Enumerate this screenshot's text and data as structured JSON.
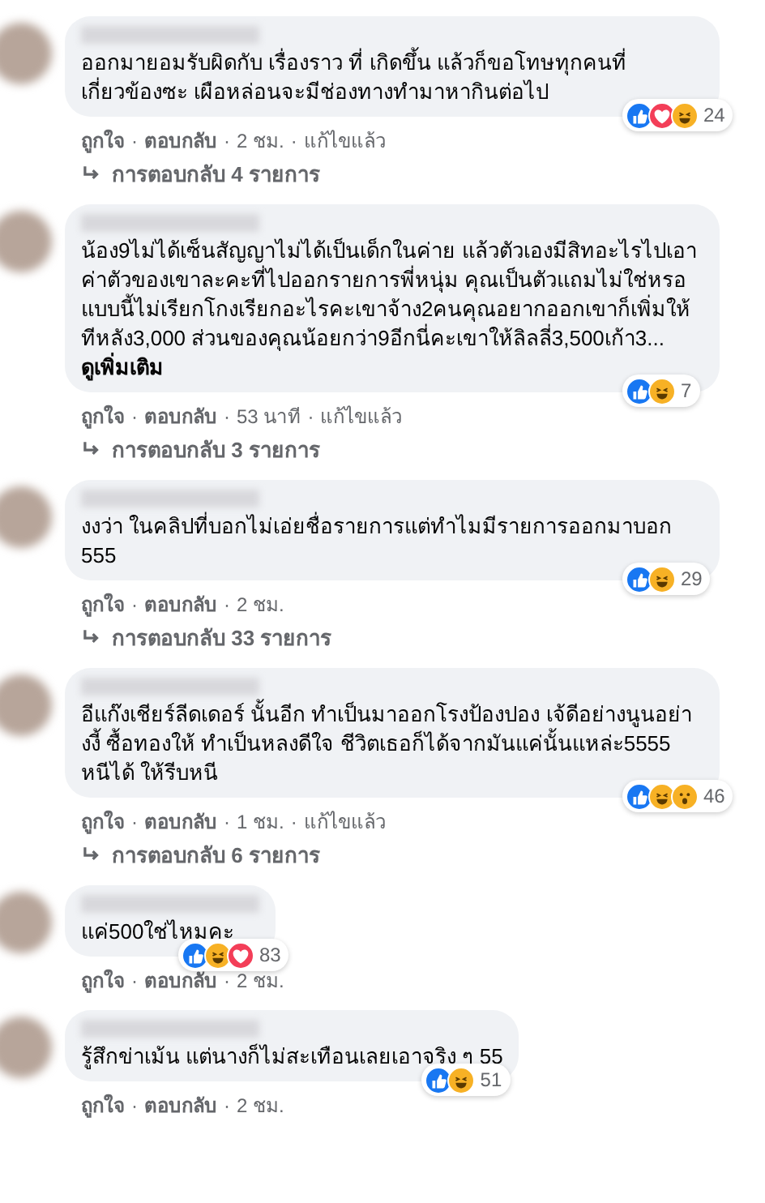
{
  "comments": [
    {
      "text": "ออกมายอมรับผิดกับ เรื่องราว ที่ เกิดขึ้น แล้วก็ขอโทษทุกคนที่เกี่ยวข้องซะ เผือหล่อนจะมีช่องทางทำมาหากินต่อไป",
      "reactions": [
        {
          "kind": "like"
        },
        {
          "kind": "love"
        },
        {
          "kind": "haha"
        }
      ],
      "reaction_count": "24",
      "actions": [
        {
          "kind": "link",
          "text": "ถูกใจ"
        },
        {
          "kind": "separator",
          "text": "·"
        },
        {
          "kind": "link",
          "text": "ตอบกลับ"
        },
        {
          "kind": "separator",
          "text": "·"
        },
        {
          "kind": "meta",
          "text": "2 ชม."
        },
        {
          "kind": "separator",
          "text": "·"
        },
        {
          "kind": "meta",
          "text": "แก้ไขแล้ว"
        }
      ],
      "replies": "การตอบกลับ 4 รายการ"
    },
    {
      "text": "น้อง9ไม่ได้เซ็นสัญญาไม่ได้เป็นเด็กในค่าย แล้วตัวเองมีสิทอะไรไปเอาค่าตัวของเขาละคะที่ไปออกรายการพี่หนุ่ม คุณเป็นตัวแถมไม่ใช่หรอ แบบนี้ไม่เรียกโกงเรียกอะไรคะเขาจ้าง2คนคุณอยากออกเขาก็เพิ่มให้ทีหลัง3,000 ส่วนของคุณน้อยกว่า9อีกนี่คะเขาให้ลิลลี่3,500เก้า3...",
      "see_more": "ดูเพิ่มเติม",
      "reactions": [
        {
          "kind": "like"
        },
        {
          "kind": "haha"
        }
      ],
      "reaction_count": "7",
      "actions": [
        {
          "kind": "link",
          "text": "ถูกใจ"
        },
        {
          "kind": "separator",
          "text": "·"
        },
        {
          "kind": "link",
          "text": "ตอบกลับ"
        },
        {
          "kind": "separator",
          "text": "·"
        },
        {
          "kind": "meta",
          "text": "53 นาที"
        },
        {
          "kind": "separator",
          "text": "·"
        },
        {
          "kind": "meta",
          "text": "แก้ไขแล้ว"
        }
      ],
      "replies": "การตอบกลับ 3 รายการ"
    },
    {
      "text": "งงว่า ในคลิปที่บอกไม่เอ่ยชื่อรายการแต่ทำไมมีรายการออกมาบอก 555",
      "reactions": [
        {
          "kind": "like"
        },
        {
          "kind": "haha"
        }
      ],
      "reaction_count": "29",
      "actions": [
        {
          "kind": "link",
          "text": "ถูกใจ"
        },
        {
          "kind": "separator",
          "text": "·"
        },
        {
          "kind": "link",
          "text": "ตอบกลับ"
        },
        {
          "kind": "separator",
          "text": "·"
        },
        {
          "kind": "meta",
          "text": "2 ชม."
        }
      ],
      "replies": "การตอบกลับ 33 รายการ"
    },
    {
      "text": "อีแก๊งเชียร์ลีดเดอร์ นั้นอีก ทำเป็นมาออกโรงป้องปอง เจ้ดีอย่างนูนอย่างงี้ ซื้อทองให้ ทำเป็นหลงดีใจ ชีวิตเธอก็ได้จากมันแค่นั้นแหล่ะ5555 หนีได้ ให้รีบหนี",
      "reactions": [
        {
          "kind": "like"
        },
        {
          "kind": "haha"
        },
        {
          "kind": "wow"
        }
      ],
      "reaction_count": "46",
      "actions": [
        {
          "kind": "link",
          "text": "ถูกใจ"
        },
        {
          "kind": "separator",
          "text": "·"
        },
        {
          "kind": "link",
          "text": "ตอบกลับ"
        },
        {
          "kind": "separator",
          "text": "·"
        },
        {
          "kind": "meta",
          "text": "1 ชม."
        },
        {
          "kind": "separator",
          "text": "·"
        },
        {
          "kind": "meta",
          "text": "แก้ไขแล้ว"
        }
      ],
      "replies": "การตอบกลับ 6 รายการ"
    },
    {
      "text": "แค่500ใช่ไหมคะ",
      "reactions": [
        {
          "kind": "like"
        },
        {
          "kind": "haha"
        },
        {
          "kind": "love"
        }
      ],
      "reaction_count": "83",
      "actions": [
        {
          "kind": "link",
          "text": "ถูกใจ"
        },
        {
          "kind": "separator",
          "text": "·"
        },
        {
          "kind": "link",
          "text": "ตอบกลับ"
        },
        {
          "kind": "separator",
          "text": "·"
        },
        {
          "kind": "meta",
          "text": "2 ชม."
        }
      ]
    },
    {
      "text": "รู้สึกข่าเม้น แต่นางก็ไม่สะเทือนเลยเอาจริง ๆ 55",
      "reactions": [
        {
          "kind": "like"
        },
        {
          "kind": "haha"
        }
      ],
      "reaction_count": "51",
      "actions": [
        {
          "kind": "link",
          "text": "ถูกใจ"
        },
        {
          "kind": "separator",
          "text": "·"
        },
        {
          "kind": "link",
          "text": "ตอบกลับ"
        },
        {
          "kind": "separator",
          "text": "·"
        },
        {
          "kind": "meta",
          "text": "2 ชม."
        }
      ]
    }
  ]
}
